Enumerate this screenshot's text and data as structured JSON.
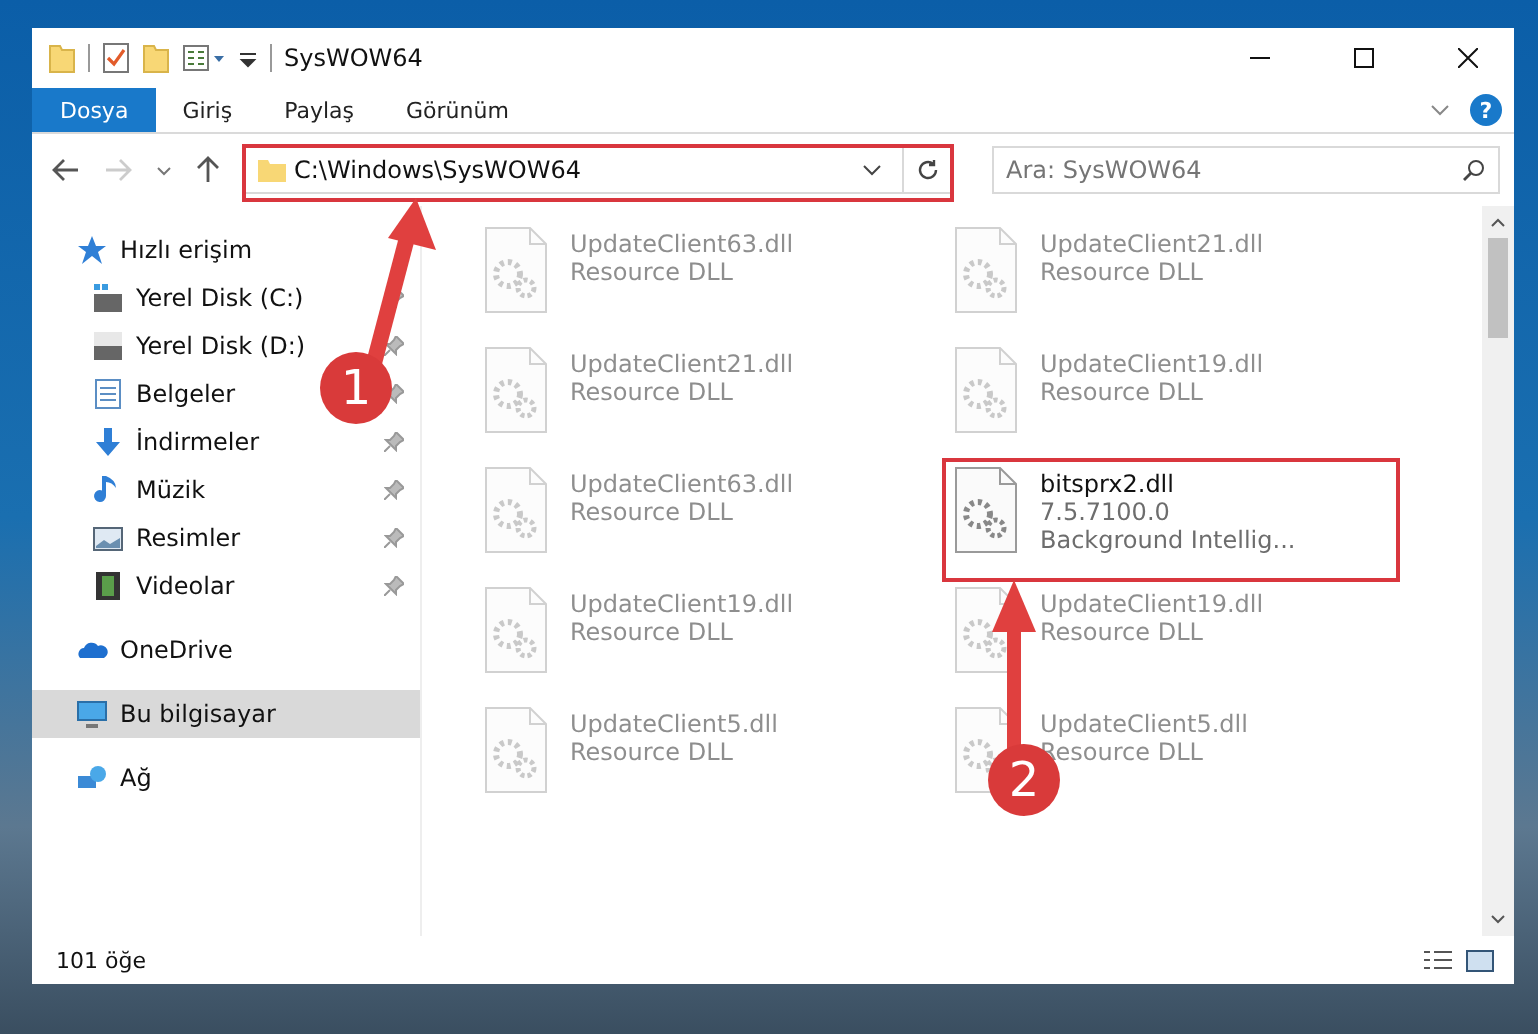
{
  "window": {
    "title": "SysWOW64",
    "help": "?"
  },
  "ribbon_tabs": [
    {
      "label": "Dosya",
      "selected": true
    },
    {
      "label": "Giriş",
      "selected": false
    },
    {
      "label": "Paylaş",
      "selected": false
    },
    {
      "label": "Görünüm",
      "selected": false
    }
  ],
  "address_bar": {
    "path": "C:\\Windows\\SysWOW64"
  },
  "search": {
    "placeholder": "Ara: SysWOW64"
  },
  "sidebar": {
    "items": [
      {
        "label": "Hızlı erişim",
        "kind": "star",
        "selected": false,
        "children": [
          {
            "label": "Yerel Disk (C:)",
            "kind": "drive-c",
            "pinned": true,
            "selected": false
          },
          {
            "label": "Yerel Disk (D:)",
            "kind": "drive",
            "pinned": true,
            "selected": false
          },
          {
            "label": "Belgeler",
            "kind": "document",
            "pinned": true,
            "selected": false
          },
          {
            "label": "İndirmeler",
            "kind": "download",
            "pinned": true,
            "selected": false
          },
          {
            "label": "Müzik",
            "kind": "music",
            "pinned": true,
            "selected": false
          },
          {
            "label": "Resimler",
            "kind": "picture",
            "pinned": true,
            "selected": false
          },
          {
            "label": "Videolar",
            "kind": "video",
            "pinned": true,
            "selected": false
          }
        ]
      },
      {
        "label": "OneDrive",
        "kind": "cloud",
        "selected": false
      },
      {
        "label": "Bu bilgisayar",
        "kind": "computer",
        "selected": true
      },
      {
        "label": "Ağ",
        "kind": "network",
        "selected": false
      }
    ]
  },
  "files": [
    {
      "name": "UpdateClient63.dll",
      "details": [
        "Resource DLL"
      ],
      "faded": true
    },
    {
      "name": "UpdateClient21.dll",
      "details": [
        "Resource DLL"
      ],
      "faded": true
    },
    {
      "name": "UpdateClient21.dll",
      "details": [
        "Resource DLL"
      ],
      "faded": true
    },
    {
      "name": "UpdateClient19.dll",
      "details": [
        "Resource DLL"
      ],
      "faded": true
    },
    {
      "name": "UpdateClient63.dll",
      "details": [
        "Resource DLL"
      ],
      "faded": true
    },
    {
      "name": "bitsprx2.dll",
      "details": [
        "7.5.7100.0",
        "Background Intellig..."
      ],
      "faded": false
    },
    {
      "name": "UpdateClient19.dll",
      "details": [
        "Resource DLL"
      ],
      "faded": true
    },
    {
      "name": "UpdateClient19.dll",
      "details": [
        "Resource DLL"
      ],
      "faded": true
    },
    {
      "name": "UpdateClient5.dll",
      "details": [
        "Resource DLL"
      ],
      "faded": true
    },
    {
      "name": "UpdateClient5.dll",
      "details": [
        "Resource DLL"
      ],
      "faded": true
    }
  ],
  "status_bar": {
    "item_count": "101 öğe"
  },
  "annotations": [
    {
      "number": "1"
    },
    {
      "number": "2"
    }
  ]
}
